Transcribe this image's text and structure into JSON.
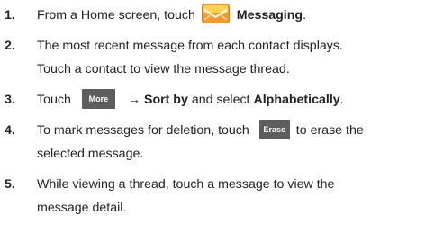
{
  "steps": [
    {
      "number": "1.",
      "parts": [
        "From a Home screen, touch",
        "Messaging",
        "."
      ]
    },
    {
      "number": "2.",
      "lines": [
        "The most recent message from each contact displays.",
        "Touch a contact to view the message thread."
      ]
    },
    {
      "number": "3.",
      "parts": [
        "Touch",
        "More",
        "→ Sort by",
        "and select",
        "Alphabetically",
        "."
      ]
    },
    {
      "number": "4.",
      "parts": [
        "To mark messages for deletion, touch",
        "Erase",
        "to erase the"
      ],
      "line2": "selected message."
    },
    {
      "number": "5.",
      "lines": [
        "While viewing a thread, touch a message to view the",
        "message detail."
      ]
    }
  ],
  "icons": {
    "messaging": "messaging-app-icon"
  },
  "colors": {
    "text": "#222222",
    "button_bg": "#5d5d5d",
    "button_text": "#ffffff",
    "icon_orange": "#f29a2e",
    "icon_yellow": "#ffd25a"
  }
}
